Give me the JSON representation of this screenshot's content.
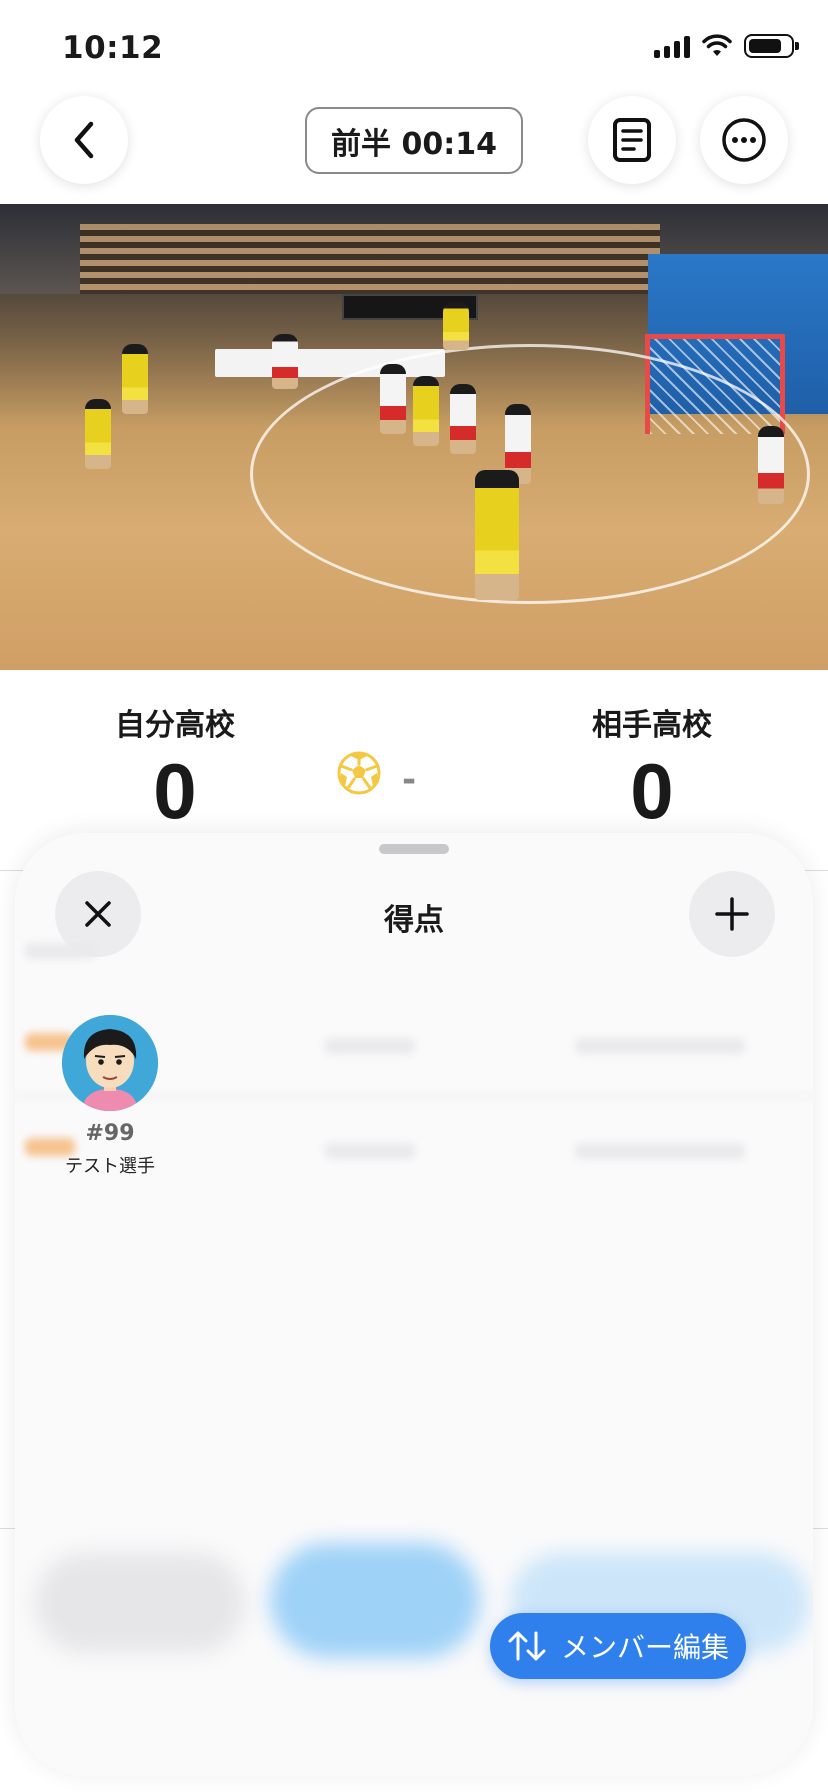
{
  "status_bar": {
    "time": "10:12"
  },
  "header": {
    "timer": "前半 00:14"
  },
  "video": {
    "icon": "handball-game-video"
  },
  "score": {
    "home_team": "自分高校",
    "home_score": "0",
    "away_team": "相手高校",
    "away_score": "0",
    "separator": "-"
  },
  "sheet": {
    "title": "得点",
    "players": [
      {
        "number": "#99",
        "name": "テスト選手"
      }
    ],
    "member_edit_label": "メンバー編集"
  },
  "colors": {
    "accent": "#2f80ed",
    "ball": "#f5c842"
  }
}
